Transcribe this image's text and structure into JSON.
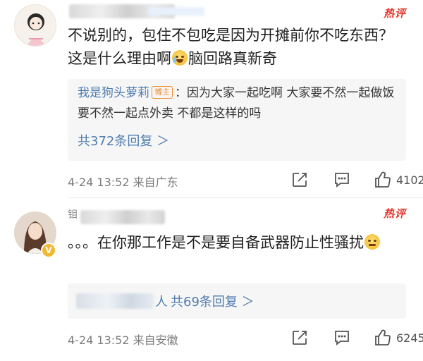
{
  "comments": [
    {
      "hot_badge": "热评",
      "text_before_emoji": "不说别的，包住不包吃是因为开摊前你不吃东西？这是什么理由啊",
      "text_after_emoji": "脑回路真新奇",
      "reply": {
        "name": "我是狗头萝莉",
        "author_badge": "博主",
        "text": "：因为大家一起吃啊 大家要不然一起做饭要不然一起点外卖 不都是这样的吗",
        "count_label": "共372条回复 ＞"
      },
      "date": "4-24 13:52",
      "source": "来自广东",
      "likes": "4102"
    },
    {
      "username_fragment": "钼",
      "hot_badge": "热评",
      "text_before_emoji": "。。。在你那工作是不是要自备武器防止性骚扰",
      "text_after_emoji": "",
      "reply": {
        "name_fragment": "人",
        "count_label": "共69条回复 ＞"
      },
      "date": "4-24 13:52",
      "source": "来自安徽",
      "likes": "6245"
    }
  ],
  "colors": {
    "link": "#507daf",
    "hot": "#e5352b",
    "meta": "#7d7d7d"
  },
  "icons": [
    "share-icon",
    "comment-icon",
    "like-icon",
    "verified-icon",
    "laughing-tears-emoji",
    "sleepy-emoji"
  ]
}
